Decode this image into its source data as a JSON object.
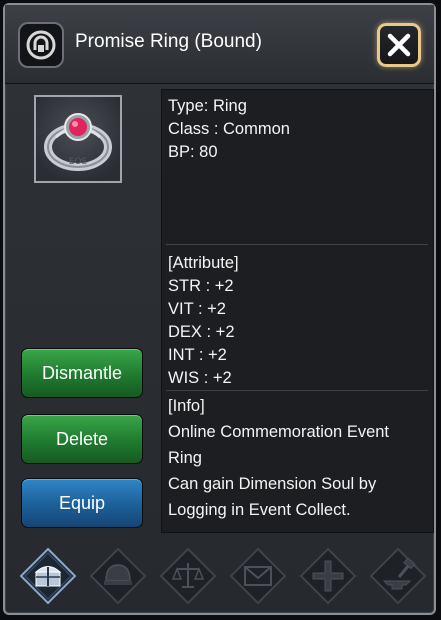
{
  "header": {
    "title": "Promise Ring (Bound)",
    "lock_icon": "bound-lock-icon",
    "close_icon": "close-x-icon"
  },
  "item": {
    "icon": "ring-icon",
    "engraving": "EOS"
  },
  "actions": {
    "dismantle_label": "Dismantle",
    "delete_label": "Delete",
    "equip_label": "Equip"
  },
  "stats": {
    "type": "Type: Ring",
    "class": "Class : Common",
    "bp": "BP: 80"
  },
  "attributes": {
    "heading": "[Attribute]",
    "lines": [
      "STR : +2",
      "VIT : +2",
      "DEX : +2",
      "INT : +2",
      "WIS : +2"
    ]
  },
  "info": {
    "heading": "[Info]",
    "lines": [
      "Online Commemoration Event",
      "Ring",
      "Can gain Dimension Soul by",
      "Logging in Event Collect."
    ]
  },
  "tabs": [
    {
      "icon": "treasure-chest-icon",
      "active": true
    },
    {
      "icon": "helmet-icon",
      "active": false
    },
    {
      "icon": "balance-scale-icon",
      "active": false
    },
    {
      "icon": "mail-icon",
      "active": false
    },
    {
      "icon": "cross-icon",
      "active": false
    },
    {
      "icon": "anvil-hammer-icon",
      "active": false
    }
  ],
  "colors": {
    "green_button": "#1f7a2f",
    "blue_button": "#1c5f98",
    "close_border": "#e9c88a",
    "gem": "#e0245e"
  }
}
